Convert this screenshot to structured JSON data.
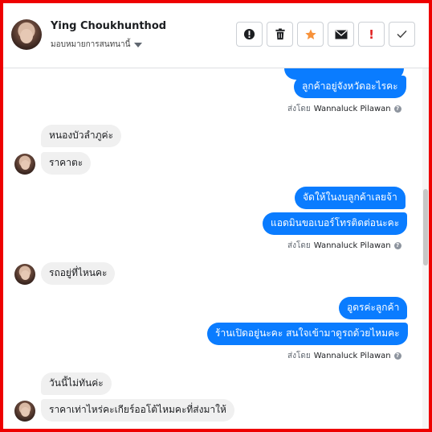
{
  "header": {
    "name": "Ying Choukhunthod",
    "assign_label": "มอบหมายการสนทนานี้"
  },
  "toolbar": {
    "icons": [
      "alert-circle-icon",
      "trash-icon",
      "star-icon",
      "envelope-icon",
      "exclamation-icon",
      "checkmark-icon"
    ]
  },
  "colors": {
    "outgoing_bubble": "#0a7cff",
    "incoming_bubble": "#f0f0f0",
    "frame_border": "#ee0000",
    "star": "#f7923a"
  },
  "sent_by_prefix": "ส่งโดย",
  "messages": [
    {
      "dir": "out",
      "text": "ลูกค้าอยู่จังหวัดอะไรคะ"
    },
    {
      "dir": "in",
      "text": "หนองบัวลำภูค่ะ"
    },
    {
      "dir": "in",
      "text": "ราคาตะ"
    },
    {
      "dir": "out",
      "text": "จัดให้ในงบลูกค้าเลยจ้า"
    },
    {
      "dir": "out",
      "text": "แอดมินขอเบอร์โทรติดต่อนะคะ"
    },
    {
      "dir": "in",
      "text": "รถอยู่ที่ไหนคะ"
    },
    {
      "dir": "out",
      "text": "อูดรค่ะลูกค้า"
    },
    {
      "dir": "out",
      "text": "ร้านเปิดอยู่นะคะ สนใจเข้ามาดูรถด้วยไหมคะ"
    },
    {
      "dir": "in",
      "text": "วันนี้ไม่ทันค่ะ"
    },
    {
      "dir": "in",
      "text": "ราคาเท่าไหร่คะเกียร์ออโต้ไหมคะที่ส่งมาให้"
    }
  ],
  "sent_by": [
    {
      "prefix": "ส่งโดย",
      "name": "Wannaluck Pilawan"
    },
    {
      "prefix": "ส่งโดย",
      "name": "Wannaluck Pilawan"
    },
    {
      "prefix": "ส่งโดย",
      "name": "Wannaluck Pilawan"
    }
  ]
}
